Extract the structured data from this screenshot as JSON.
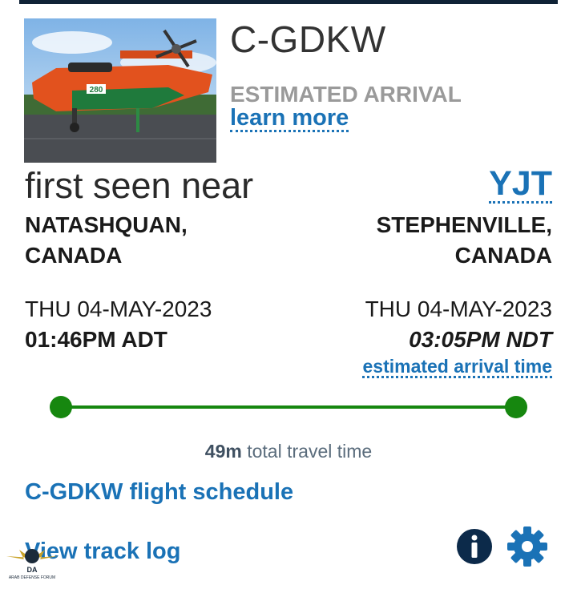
{
  "flight": {
    "tail": "C-GDKW",
    "estimated_arrival_label": "ESTIMATED ARRIVAL",
    "learn_more": "learn more"
  },
  "photo": {
    "aircraft_number": "280"
  },
  "origin": {
    "heading": "first seen near",
    "place_line1": "NATASHQUAN,",
    "place_line2": "CANADA",
    "date": "THU 04-MAY-2023",
    "time": "01:46PM ADT"
  },
  "destination": {
    "code": "YJT",
    "place_line1": "STEPHENVILLE,",
    "place_line2": "CANADA",
    "date": "THU 04-MAY-2023",
    "time": "03:05PM NDT",
    "est_link": "estimated arrival time"
  },
  "travel": {
    "duration": "49m",
    "suffix": "total travel time"
  },
  "progress": {
    "fraction": 1.0,
    "color": "#16870f"
  },
  "links": {
    "schedule": "C-GDKW flight schedule",
    "track_log": "View track log"
  },
  "watermark": {
    "letters": "DA",
    "text": "ARAB DEFENSE FORUM"
  },
  "icons": {
    "info": "info-icon",
    "settings": "gear-icon"
  },
  "colors": {
    "link": "#1a72b6",
    "progress": "#16870f",
    "muted": "#9a9a9a"
  }
}
